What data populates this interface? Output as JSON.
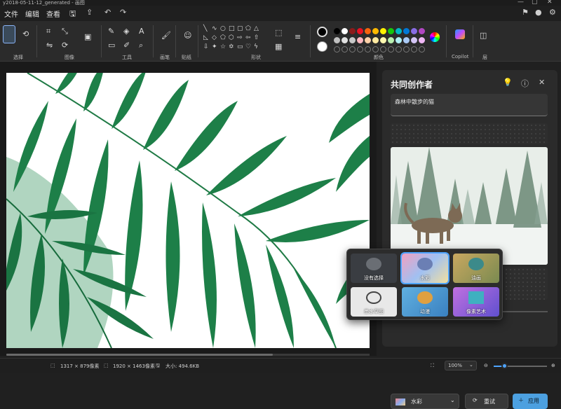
{
  "window": {
    "title": "y2018-05-11-12_generated - 画图",
    "controls": [
      "—",
      "▢",
      "✕"
    ]
  },
  "menu": {
    "file": "文件",
    "edit": "编辑",
    "view": "查看"
  },
  "ribbon": {
    "groups": {
      "select": "选择",
      "image": "图像",
      "tools": "工具",
      "brushes": "画笔",
      "stickers": "贴纸",
      "shapes": "形状",
      "colors": "颜色",
      "copilot": "Copilot",
      "layers": "层"
    },
    "palette_row1": [
      "#000000",
      "#ffffff",
      "#8b1a1a",
      "#e81123",
      "#f7630c",
      "#ffb900",
      "#fff100",
      "#16c60c",
      "#00b7c3",
      "#0078d7",
      "#886ce4",
      "#b146c2"
    ],
    "palette_row2": [
      "#c0c0c0",
      "#e0e0e0",
      "#c8c8c8",
      "#ffb8c0",
      "#ffd1a8",
      "#ffe9a0",
      "#fff9b0",
      "#b8f0b0",
      "#b0f0f5",
      "#a9c9f5",
      "#d4c5f5",
      "#f0b8f5"
    ],
    "primary_color": "#000000",
    "secondary_color": "#ffffff"
  },
  "cocreator": {
    "title": "共同创作者",
    "prompt": "森林中散步的猫",
    "styles": [
      {
        "label": "没有选择",
        "selected": false
      },
      {
        "label": "水彩",
        "selected": true
      },
      {
        "label": "油画",
        "selected": false
      },
      {
        "label": "墨水草图",
        "selected": false
      },
      {
        "label": "动漫",
        "selected": false
      },
      {
        "label": "像素艺术",
        "selected": false
      }
    ],
    "style_dropdown": "水彩",
    "retry_label": "重试",
    "apply_label": "应用"
  },
  "status": {
    "selection": "1317 × 879像素",
    "canvas_size": "1920 × 1463像素",
    "file_size": "大小: 494.6KB",
    "zoom": "100%",
    "zoom_slider": 0.2
  }
}
